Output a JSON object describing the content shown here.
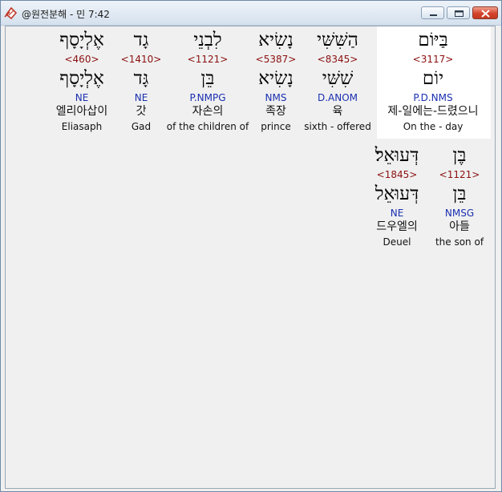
{
  "window": {
    "title": "@원전분해 - 민 7:42",
    "controls": {
      "minimize": "minimize",
      "maximize": "maximize",
      "close": "close"
    }
  },
  "rows": [
    {
      "words": [
        {
          "hebrew": "בַּיּוֹם",
          "strong": "<3117>",
          "lemma": "יוֹם",
          "morph": "P.D.NMS",
          "korean": "제-일에는-드렸으니",
          "english": "On the - day",
          "highlighted": true
        },
        {
          "hebrew": "הַשִּׁשִּׁי",
          "strong": "<8345>",
          "lemma": "שִׁשִּׁי",
          "morph": "D.ANOM",
          "korean": "육",
          "english": "sixth - offered"
        },
        {
          "hebrew": "נָשִׂיא",
          "strong": "<5387>",
          "lemma": "נָשִׂיא",
          "morph": "NMS",
          "korean": "족장",
          "english": "prince"
        },
        {
          "hebrew": "לִבְנֵי",
          "strong": "<1121>",
          "lemma": "בֵּן",
          "morph": "P.NMPG",
          "korean": "자손의",
          "english": "of the children of"
        },
        {
          "hebrew": "גָד",
          "strong": "<1410>",
          "lemma": "גָּד",
          "morph": "NE",
          "korean": "갓",
          "english": "Gad"
        },
        {
          "hebrew": "אֶלְיָסָף",
          "strong": "<460>",
          "lemma": "אֶלְיָסָף",
          "morph": "NE",
          "korean": "엘리아삽이",
          "english": "Eliasaph"
        }
      ]
    },
    {
      "words": [
        {
          "hebrew": "בֶּן",
          "strong": "<1121>",
          "lemma": "בֵּן",
          "morph": "NMSG",
          "korean": "아들",
          "english": "the son of"
        },
        {
          "hebrew": "דְּעוּאֵל׃",
          "strong": "<1845>",
          "lemma": "דְּעוּאֵל",
          "morph": "NE",
          "korean": "드우엘의",
          "english": "Deuel"
        }
      ]
    }
  ]
}
